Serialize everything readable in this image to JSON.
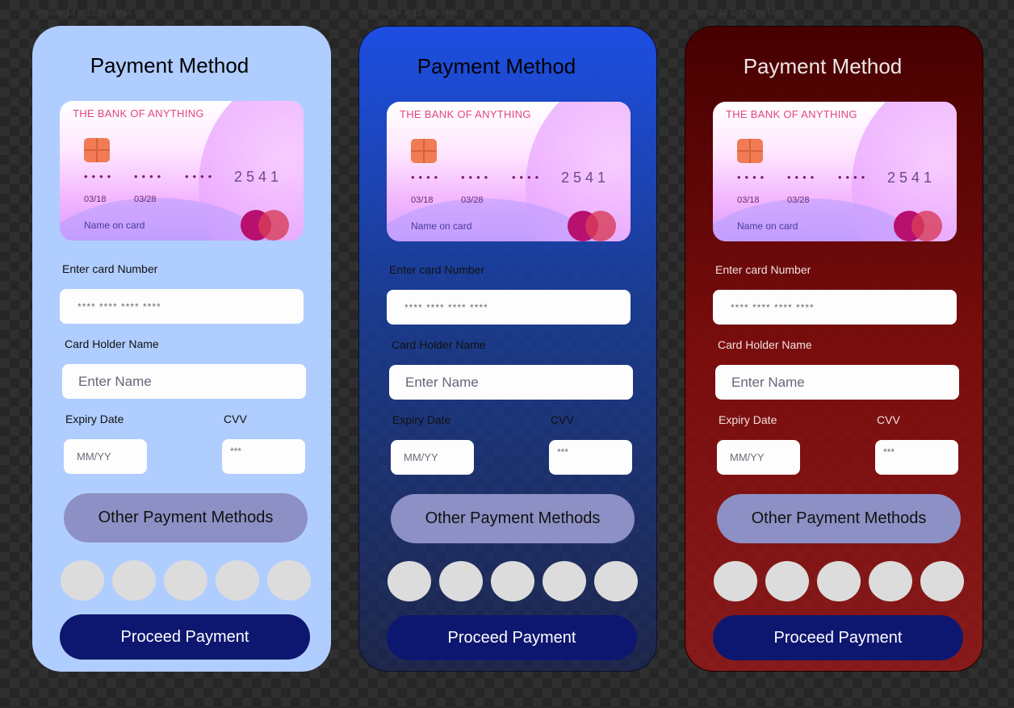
{
  "frame_labels": [
    "iPhone 14 & 15 Pro Max - 1",
    "iPhone 14 & 15 Pro Max - 2",
    "iPhone 14 & 15 Pro Max - 3"
  ],
  "screen": {
    "title": "Payment Method",
    "card": {
      "bank_name": "THE BANK OF ANYTHING",
      "masked_group": "••••",
      "last_four": "2541",
      "valid_from": "03/18",
      "valid_thru": "03/28",
      "holder_label": "Name on card",
      "brand_icon": "mastercard-icon",
      "chip_icon": "chip-icon"
    },
    "card_number_label": "Enter card Number",
    "card_number_placeholder": "**** **** **** ****",
    "holder_name_label": "Card Holder Name",
    "holder_name_placeholder": "Enter Name",
    "expiry_label": "Expiry Date",
    "expiry_placeholder": "MM/YY",
    "cvv_label": "CVV",
    "cvv_placeholder": "***",
    "other_methods_label": "Other Payment Methods",
    "method_icons": [
      "payment-option-1",
      "payment-option-2",
      "payment-option-3",
      "payment-option-4",
      "payment-option-5"
    ],
    "proceed_label": "Proceed Payment"
  },
  "themes": {
    "light": "#b0cdff",
    "blue": "#1d4ee2",
    "red": "#8a0a0a",
    "button_primary": "#0e1770",
    "button_secondary": "#8d90c4"
  }
}
